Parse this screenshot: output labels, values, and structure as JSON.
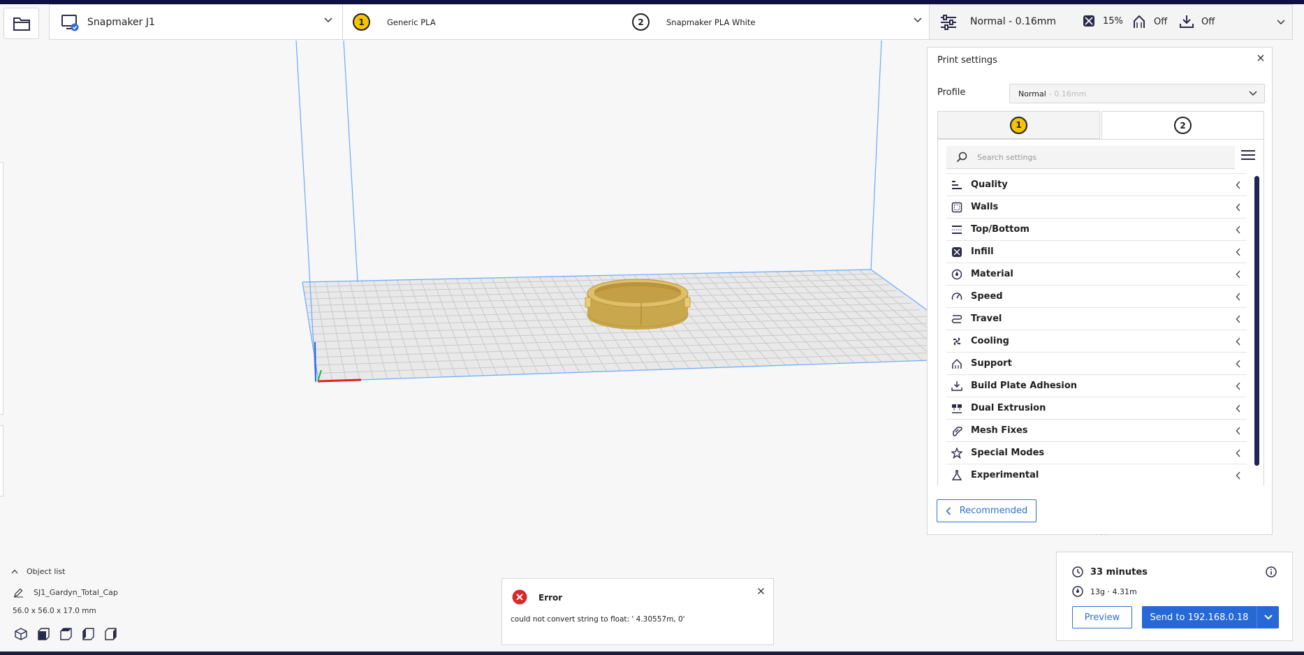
{
  "header": {
    "printer": {
      "name": "Snapmaker J1"
    },
    "extruders": [
      {
        "number": "1",
        "material": "Generic PLA"
      },
      {
        "number": "2",
        "material": "Snapmaker PLA White"
      }
    ],
    "print_setup": {
      "profile": "Normal - 0.16mm",
      "infill": "15%",
      "support": "Off",
      "adhesion": "Off"
    }
  },
  "print_settings": {
    "title": "Print settings",
    "profile_label": "Profile",
    "profile_value": "Normal",
    "profile_suffix": "- 0.16mm",
    "tabs": [
      "1",
      "2"
    ],
    "search_placeholder": "Search settings",
    "categories": [
      {
        "label": "Quality",
        "icon": "quality-icon"
      },
      {
        "label": "Walls",
        "icon": "walls-icon"
      },
      {
        "label": "Top/Bottom",
        "icon": "top-bottom-icon"
      },
      {
        "label": "Infill",
        "icon": "infill-icon"
      },
      {
        "label": "Material",
        "icon": "material-icon"
      },
      {
        "label": "Speed",
        "icon": "speed-icon"
      },
      {
        "label": "Travel",
        "icon": "travel-icon"
      },
      {
        "label": "Cooling",
        "icon": "cooling-icon"
      },
      {
        "label": "Support",
        "icon": "support-icon"
      },
      {
        "label": "Build Plate Adhesion",
        "icon": "adhesion-icon"
      },
      {
        "label": "Dual Extrusion",
        "icon": "dual-extrusion-icon"
      },
      {
        "label": "Mesh Fixes",
        "icon": "mesh-fixes-icon"
      },
      {
        "label": "Special Modes",
        "icon": "special-modes-icon"
      },
      {
        "label": "Experimental",
        "icon": "experimental-icon"
      }
    ],
    "recommended_label": "Recommended"
  },
  "object_list": {
    "label": "Object list",
    "object_name": "SJ1_Gardyn_Total_Cap",
    "dimensions": "56.0 x 56.0 x 17.0 mm"
  },
  "error": {
    "title": "Error",
    "message": "could not convert string to float: ' 4.30557m, 0'"
  },
  "estimate": {
    "time": "33 minutes",
    "material": "13g · 4.31m",
    "preview_label": "Preview",
    "send_label": "Send to 192.168.0.18"
  },
  "colors": {
    "accent": "#2668d6",
    "extruder_1": "#f5c400",
    "model": "#d9b85a",
    "top_strip": "#0f0f45"
  }
}
